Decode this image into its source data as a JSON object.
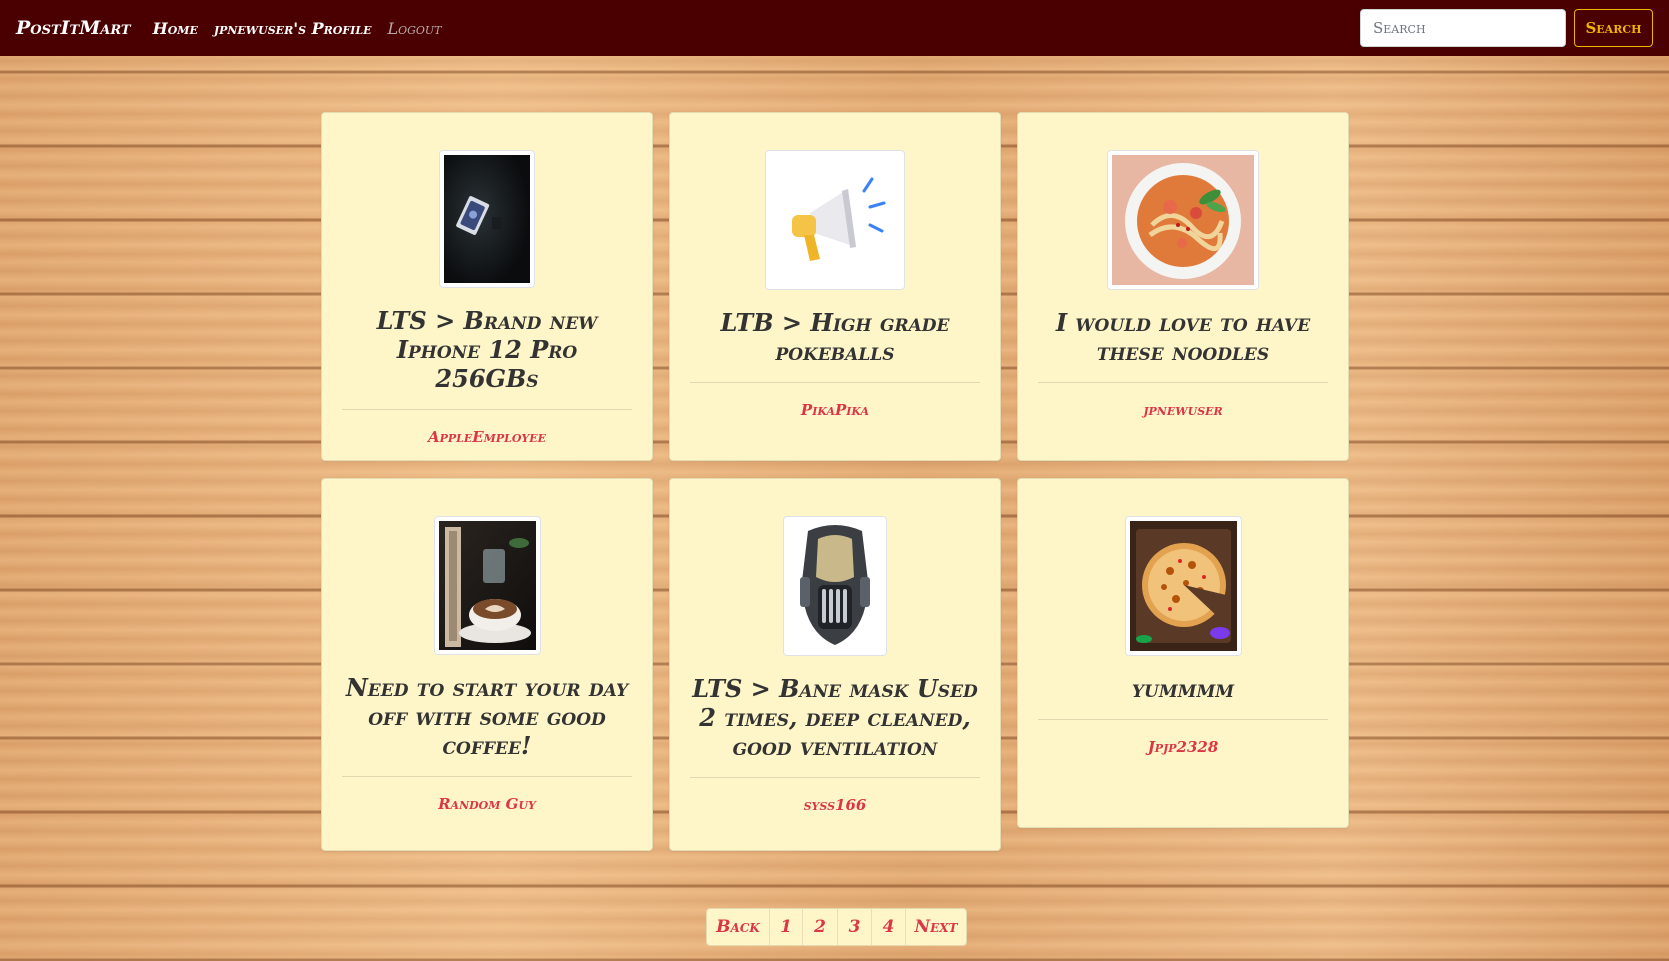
{
  "navbar": {
    "brand": "PostItMart",
    "links": [
      "Home",
      "jpnewuser's Profile",
      "Logout"
    ],
    "search_placeholder": "Search",
    "search_button": "Search",
    "background": "#4a0000",
    "accent": "#f0b400"
  },
  "posts": [
    {
      "title": "LTS > Brand new Iphone 12 Pro 256GBs",
      "author": "AppleEmployee",
      "image": "phone-box-photo"
    },
    {
      "title": "LTB > High grade pokeballs",
      "author": "PikaPika",
      "image": "megaphone-icon"
    },
    {
      "title": "I would love to have these noodles",
      "author": "jpnewuser",
      "image": "noodle-bowl-photo"
    },
    {
      "title": "Need to start your day off with some good coffee!",
      "author": "Random Guy",
      "image": "latte-photo"
    },
    {
      "title": "LTS > Bane mask Used 2 times, deep cleaned, good ventilation",
      "author": "syss166",
      "image": "bane-mask-photo"
    },
    {
      "title": "yummmm",
      "author": "Jpjp2328",
      "image": "pizza-photo"
    }
  ],
  "pagination": {
    "back": "Back",
    "pages": [
      "1",
      "2",
      "3",
      "4"
    ],
    "next": "Next"
  },
  "colors": {
    "card_background": "#fef6c9",
    "author_text": "#dc3545",
    "title_text": "#333333"
  }
}
